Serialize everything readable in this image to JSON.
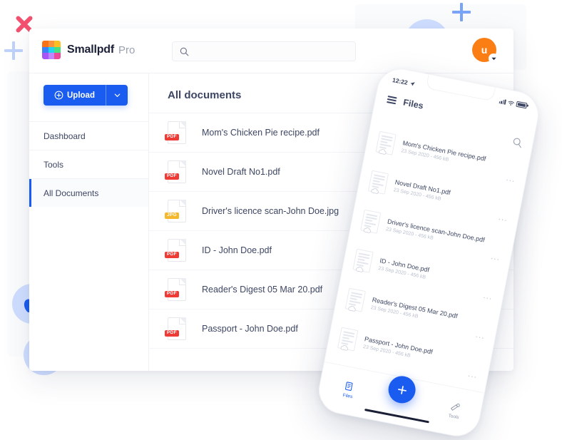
{
  "colors": {
    "brand_blue": "#1a5cf0",
    "avatar_orange": "#fb7e14",
    "pdf_red": "#ef3b36",
    "jpg_yellow": "#f5b72b",
    "badge_bg": "#cfdeff",
    "accent_pink": "#f2506e",
    "ring_gold": "#f5b92b",
    "text_dark": "#3d4663",
    "text_muted": "#b9bfcd"
  },
  "logo": {
    "name": "Smallpdf",
    "plan": "Pro",
    "tiles": [
      "#f97316",
      "#fb923c",
      "#fbbf24",
      "#3b82f6",
      "#22d3ee",
      "#4ade80",
      "#a855f7",
      "#c084fc",
      "#ec4899"
    ]
  },
  "search": {
    "placeholder": "",
    "value": "",
    "icon": "search-icon"
  },
  "account": {
    "initial": "u",
    "caret_icon": "chevron-down-icon"
  },
  "sidebar": {
    "upload": {
      "label": "Upload",
      "icon": "plus-circle-icon",
      "caret_icon": "chevron-down-icon"
    },
    "items": [
      {
        "label": "Dashboard",
        "active": false
      },
      {
        "label": "Tools",
        "active": false
      },
      {
        "label": "All Documents",
        "active": true
      }
    ]
  },
  "main": {
    "title": "All documents",
    "documents": [
      {
        "name": "Mom's Chicken Pie recipe.pdf",
        "type": "PDF"
      },
      {
        "name": "Novel Draft No1.pdf",
        "type": "PDF"
      },
      {
        "name": "Driver's licence scan-John Doe.jpg",
        "type": "JPG"
      },
      {
        "name": "ID - John Doe.pdf",
        "type": "PDF"
      },
      {
        "name": "Reader's Digest 05 Mar 20.pdf",
        "type": "PDF"
      },
      {
        "name": "Passport - John Doe.pdf",
        "type": "PDF"
      }
    ]
  },
  "phone": {
    "status": {
      "time": "12:22",
      "location_icon": "location-arrow-icon",
      "signal_icon": "cellular-signal-icon",
      "wifi_icon": "wifi-icon",
      "battery_icon": "battery-icon"
    },
    "header": {
      "menu_icon": "hamburger-menu-icon",
      "title": "Files",
      "search_icon": "search-icon"
    },
    "files": [
      {
        "name": "Mom's Chicken Pie recipe.pdf",
        "meta": "23 Sep 2020 - 456 kB"
      },
      {
        "name": "Novel Draft No1.pdf",
        "meta": "23 Sep 2020 - 456 kB"
      },
      {
        "name": "Driver's licence scan-John Doe.pdf",
        "meta": "23 Sep 2020 - 456 kB"
      },
      {
        "name": "ID - John Doe.pdf",
        "meta": "23 Sep 2020 - 456 kB"
      },
      {
        "name": "Reader's Digest 05 Mar 20.pdf",
        "meta": "23 Sep 2020 - 456 kB"
      },
      {
        "name": "Passport - John Doe.pdf",
        "meta": "23 Sep 2020 - 456 kB"
      }
    ],
    "row_menu": "...",
    "tabs": [
      {
        "label": "Files",
        "icon": "files-icon",
        "active": true
      },
      {
        "label": "Tools",
        "icon": "tools-icon",
        "active": false
      }
    ],
    "fab": {
      "icon": "plus-icon",
      "label": "+"
    }
  },
  "decorations": {
    "os_badges": [
      {
        "name": "apple-icon"
      },
      {
        "name": "windows-icon"
      },
      {
        "name": "android-icon"
      }
    ],
    "cloud_badge": {
      "name": "cloud-icon"
    },
    "shapes": [
      "x-mark-shape",
      "plus-shape-left",
      "plus-shape-top",
      "gold-ring-shape"
    ]
  }
}
